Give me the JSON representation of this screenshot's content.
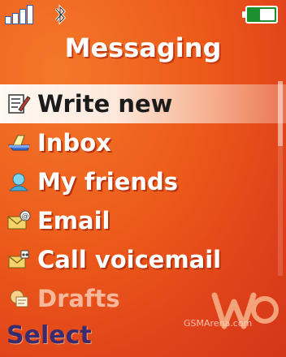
{
  "header": {
    "title": "Messaging"
  },
  "status": {
    "signal_icon": "signal-bars-icon",
    "bluetooth_icon": "bluetooth-icon",
    "battery_icon": "battery-icon",
    "signal_bars": 4,
    "battery_level": 0.5
  },
  "menu": {
    "items": [
      {
        "label": "Write new",
        "icon": "write-new-icon"
      },
      {
        "label": "Inbox",
        "icon": "inbox-icon"
      },
      {
        "label": "My friends",
        "icon": "my-friends-icon"
      },
      {
        "label": "Email",
        "icon": "email-icon"
      },
      {
        "label": "Call voicemail",
        "icon": "voicemail-icon"
      },
      {
        "label": "Drafts",
        "icon": "drafts-icon"
      }
    ],
    "selected_index": 0
  },
  "softkeys": {
    "left": "Select"
  },
  "branding": {
    "watermark": "GSMArena.com",
    "logo_icon": "walkman-logo-icon"
  },
  "colors": {
    "background": "#e24a1a",
    "highlight": "#fff5ee",
    "softkey": "#3a2b6e"
  }
}
